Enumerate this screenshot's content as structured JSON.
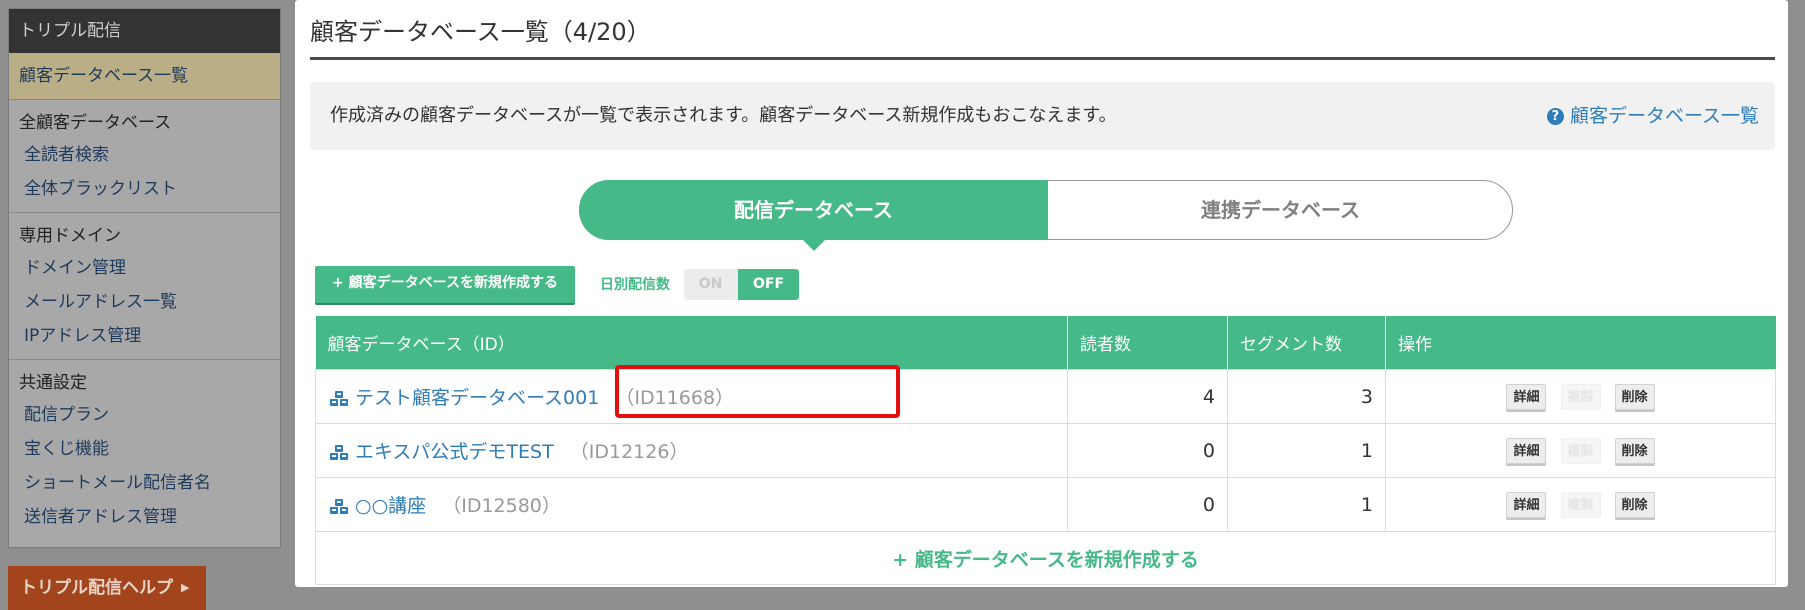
{
  "sidebar": {
    "title": "トリプル配信",
    "active_item": "顧客データベース一覧",
    "groups": [
      {
        "title": "全顧客データベース",
        "items": [
          "全読者検索",
          "全体ブラックリスト"
        ]
      },
      {
        "title": "専用ドメイン",
        "items": [
          "ドメイン管理",
          "メールアドレス一覧",
          "IPアドレス管理"
        ]
      },
      {
        "title": "共通設定",
        "items": [
          "配信プラン",
          "宝くじ機能",
          "ショートメール配信者名",
          "送信者アドレス管理"
        ]
      }
    ],
    "help_button": "トリプル配信ヘルプ"
  },
  "main": {
    "title": "顧客データベース一覧（4/20）",
    "info_text": "作成済みの顧客データベースが一覧で表示されます。顧客データベース新規作成もおこなえます。",
    "info_help_link": "顧客データベース一覧",
    "tabs": [
      {
        "label": "配信データベース",
        "active": true
      },
      {
        "label": "連携データベース",
        "active": false
      }
    ],
    "create_button": "+ 顧客データベースを新規作成する",
    "daily_label": "日別配信数",
    "toggle": {
      "on": "ON",
      "off": "OFF",
      "selected": "OFF"
    },
    "table": {
      "headers": [
        "顧客データベース（ID）",
        "読者数",
        "セグメント数",
        "操作"
      ],
      "rows": [
        {
          "name": "テスト顧客データベース001",
          "id": "（ID11668）",
          "readers": "4",
          "segments": "3"
        },
        {
          "name": "エキスパ公式デモTEST",
          "id": "（ID12126）",
          "readers": "0",
          "segments": "1"
        },
        {
          "name": "○○講座",
          "id": "（ID12580）",
          "readers": "0",
          "segments": "1"
        }
      ],
      "op_labels": {
        "detail": "詳細",
        "copy": "複製",
        "delete": "削除"
      },
      "create_row": "+ 顧客データベースを新規作成する"
    }
  },
  "colors": {
    "accent": "#45b987",
    "link": "#2e7db8",
    "highlight": "#e30e0e",
    "help": "#a3451c"
  }
}
